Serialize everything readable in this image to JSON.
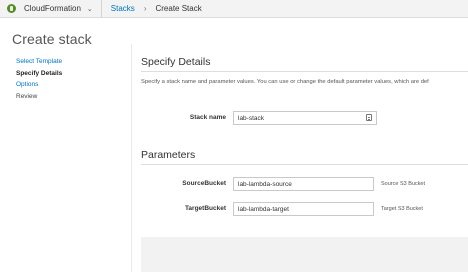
{
  "topbar": {
    "service_name": "CloudFormation",
    "service_dropdown_glyph": "⌄",
    "breadcrumbs": [
      {
        "label": "Stacks",
        "link": true
      },
      {
        "label": "Create Stack",
        "link": false
      }
    ],
    "separator": "›"
  },
  "page": {
    "title": "Create stack"
  },
  "steps": [
    {
      "label": "Select Template",
      "state": "link"
    },
    {
      "label": "Specify Details",
      "state": "active"
    },
    {
      "label": "Options",
      "state": "link"
    },
    {
      "label": "Review",
      "state": "plain"
    }
  ],
  "specify": {
    "title": "Specify Details",
    "description": "Specify a stack name and parameter values. You can use or change the default parameter values, which are def"
  },
  "stack_name": {
    "label": "Stack name",
    "value": "lab-stack"
  },
  "parameters": {
    "title": "Parameters",
    "items": [
      {
        "label": "SourceBucket",
        "value": "lab-lambda-source",
        "hint": "Source S3 Bucket"
      },
      {
        "label": "TargetBucket",
        "value": "lab-lambda-target",
        "hint": "Target S3 Bucket"
      }
    ]
  },
  "colors": {
    "link": "#0073bb",
    "service_logo": "#5a8a2e",
    "footer_background": "#f2f2f2"
  }
}
